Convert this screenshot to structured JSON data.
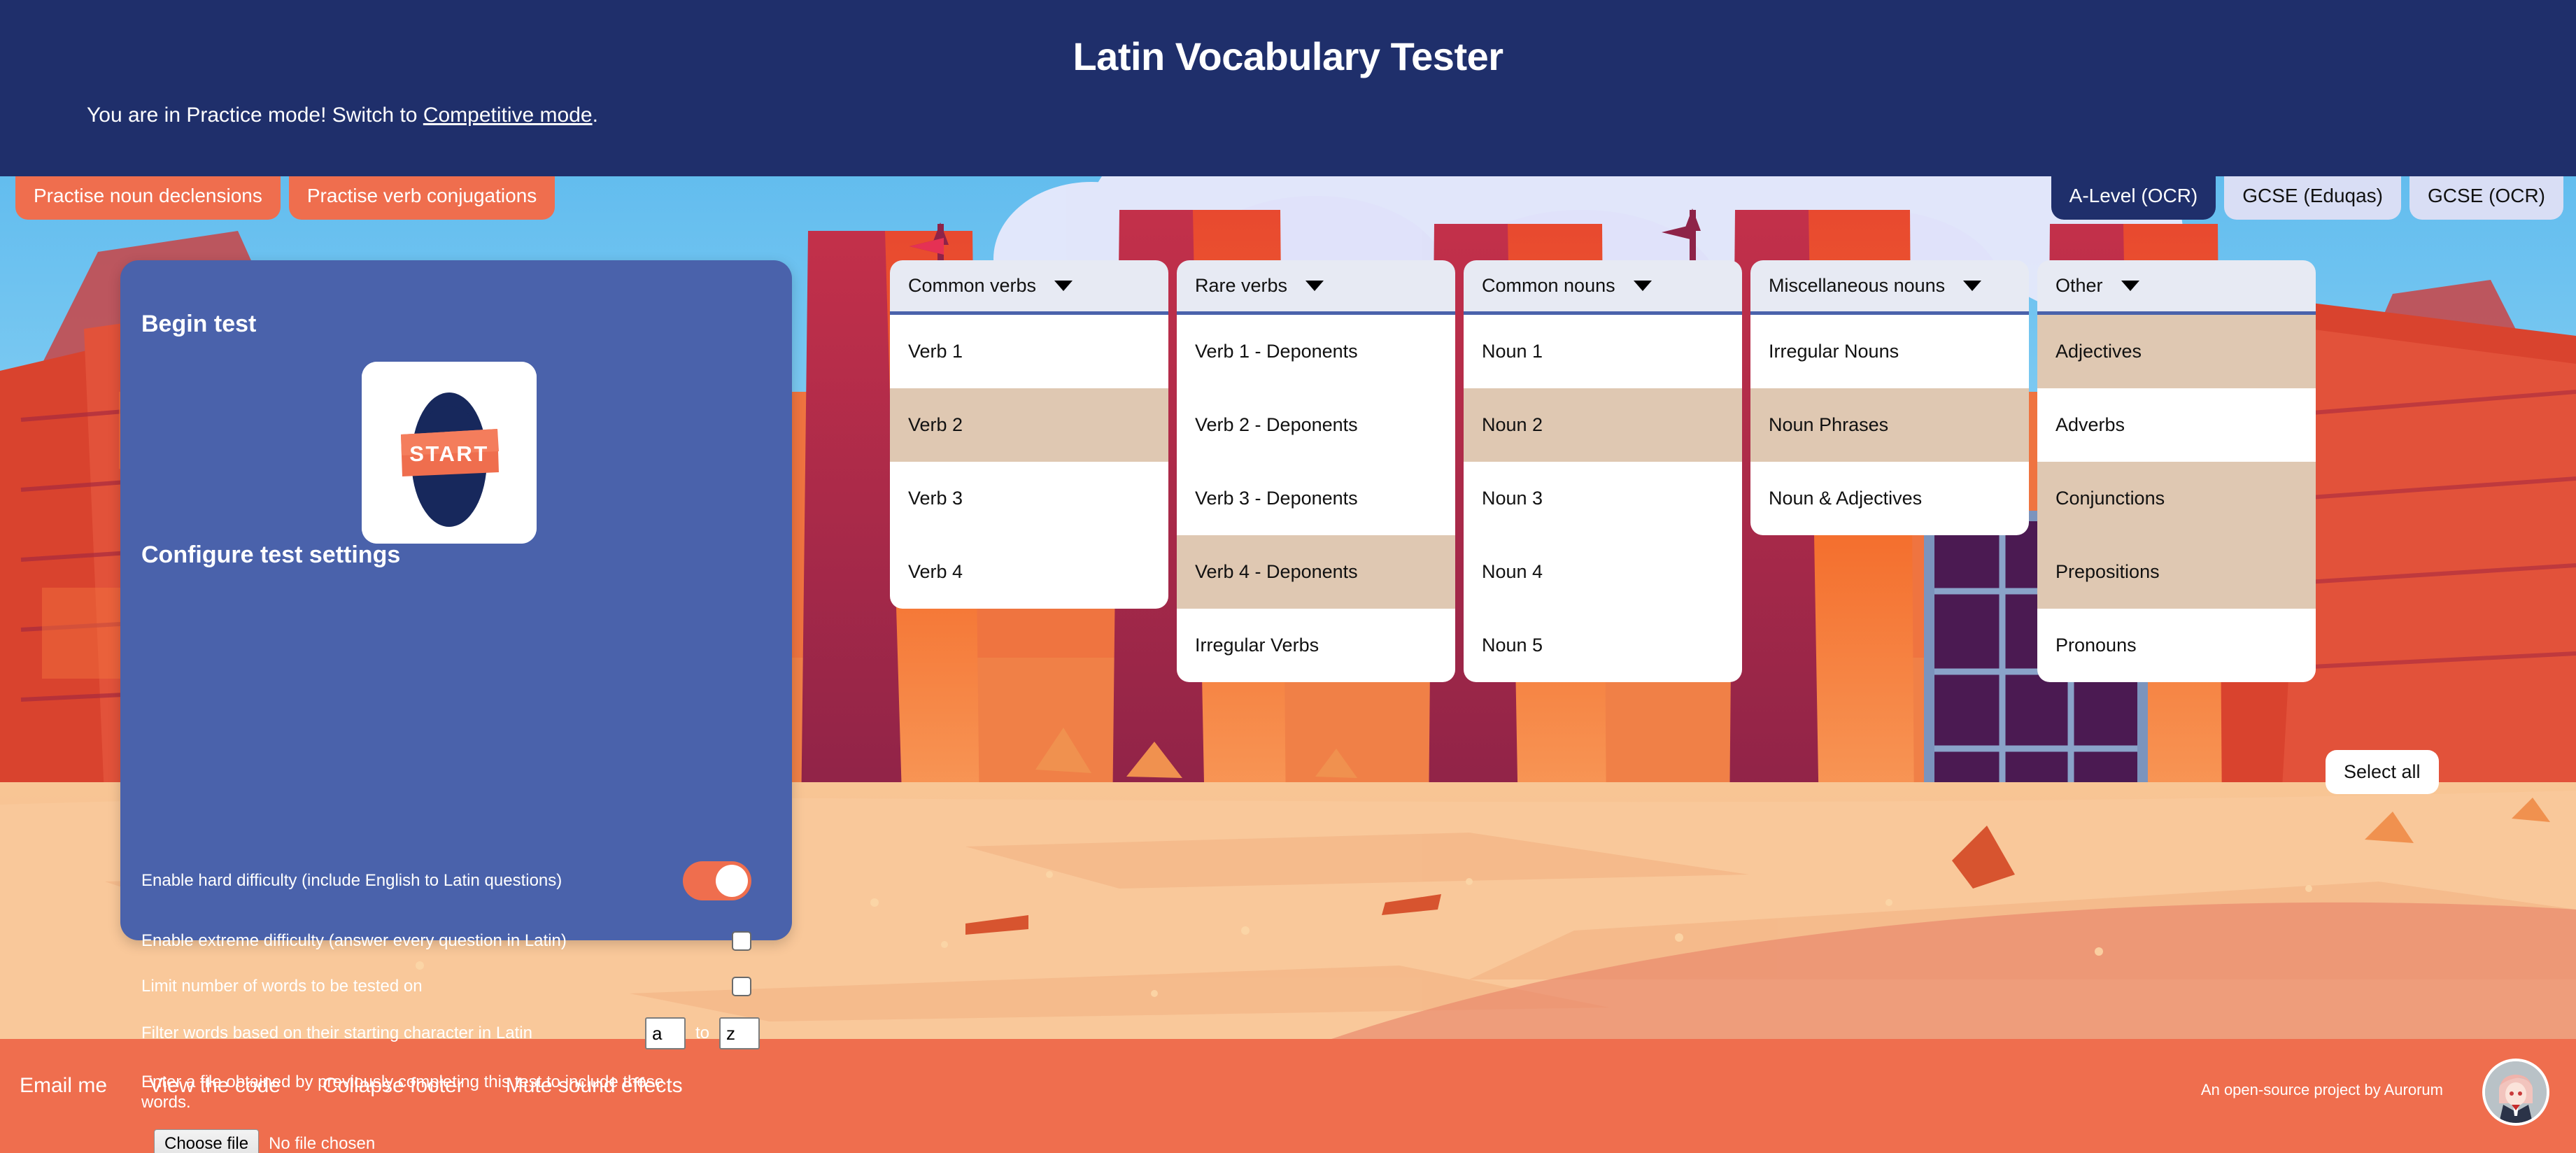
{
  "header": {
    "title": "Latin Vocabulary Tester",
    "mode_prefix": "You are in Practice mode! Switch to ",
    "mode_link": "Competitive mode",
    "mode_suffix": "."
  },
  "tabs_left": [
    {
      "label": "Practise noun declensions",
      "state": "inactive"
    },
    {
      "label": "Practise verb conjugations",
      "state": "inactive"
    }
  ],
  "tabs_right": [
    {
      "label": "A-Level (OCR)",
      "state": "active"
    },
    {
      "label": "GCSE (Eduqas)",
      "state": "inactive"
    },
    {
      "label": "GCSE (OCR)",
      "state": "inactive"
    }
  ],
  "settings": {
    "begin_heading": "Begin test",
    "start_label": "START",
    "configure_heading": "Configure test settings",
    "hard_label": "Enable hard difficulty (include English to Latin questions)",
    "hard_value": "on",
    "extreme_label": "Enable extreme difficulty (answer every question in Latin)",
    "extreme_value": "off",
    "limit_label": "Limit number of words to be tested on",
    "limit_value": "off",
    "filter_label": "Filter words based on their starting character in Latin",
    "filter_from": "a",
    "filter_to": "z",
    "filter_joiner": "to",
    "file_help": "Enter a file obtained by previously completing this test to include those words.",
    "choose_file_label": "Choose file",
    "file_status": "No file chosen"
  },
  "columns": [
    {
      "title": "Common verbs",
      "options": [
        {
          "label": "Verb 1",
          "selected": false
        },
        {
          "label": "Verb 2",
          "selected": true
        },
        {
          "label": "Verb 3",
          "selected": false
        },
        {
          "label": "Verb 4",
          "selected": false
        }
      ]
    },
    {
      "title": "Rare verbs",
      "options": [
        {
          "label": "Verb 1 - Deponents",
          "selected": false
        },
        {
          "label": "Verb 2 - Deponents",
          "selected": false
        },
        {
          "label": "Verb 3 - Deponents",
          "selected": false
        },
        {
          "label": "Verb 4 - Deponents",
          "selected": true
        },
        {
          "label": "Irregular Verbs",
          "selected": false
        }
      ]
    },
    {
      "title": "Common nouns",
      "options": [
        {
          "label": "Noun 1",
          "selected": false
        },
        {
          "label": "Noun 2",
          "selected": true
        },
        {
          "label": "Noun 3",
          "selected": false
        },
        {
          "label": "Noun 4",
          "selected": false
        },
        {
          "label": "Noun 5",
          "selected": false
        }
      ]
    },
    {
      "title": "Miscellaneous nouns",
      "options": [
        {
          "label": "Irregular Nouns",
          "selected": false
        },
        {
          "label": "Noun Phrases",
          "selected": true
        },
        {
          "label": "Noun & Adjectives",
          "selected": false
        }
      ]
    },
    {
      "title": "Other",
      "options": [
        {
          "label": "Adjectives",
          "selected": true
        },
        {
          "label": "Adverbs",
          "selected": false
        },
        {
          "label": "Conjunctions",
          "selected": true
        },
        {
          "label": "Prepositions",
          "selected": true
        },
        {
          "label": "Pronouns",
          "selected": false
        }
      ]
    }
  ],
  "select_all_label": "Select all",
  "footer": {
    "links": [
      "Email me",
      "View the code",
      "Collapse footer",
      "Mute sound effects"
    ],
    "credit": "An open-source project by Aurorum"
  },
  "colors": {
    "header_navy": "#1f2f6b",
    "accent_orange": "#ef6e4e",
    "panel_blue": "#4a62ab",
    "selected_tan": "#dfc8b2",
    "tab_pale": "#d9def5",
    "col_header_grey": "#e7eaf3"
  }
}
